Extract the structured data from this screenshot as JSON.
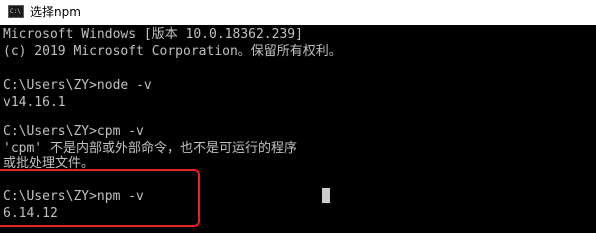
{
  "window": {
    "title": "选择npm",
    "icon": "cmd-console-icon",
    "icon_glyph": "C:\\",
    "highlight_color": "#e8211c"
  },
  "console": {
    "lines": [
      "Microsoft Windows [版本 10.0.18362.239]",
      "(c) 2019 Microsoft Corporation。保留所有权利。",
      "",
      "C:\\Users\\ZY>node -v",
      "v14.16.1",
      "",
      "C:\\Users\\ZY>cpm -v",
      "'cpm' 不是内部或外部命令，也不是可运行的程序",
      "或批处理文件。",
      "",
      "C:\\Users\\ZY>npm -v",
      "6.14.12"
    ]
  }
}
